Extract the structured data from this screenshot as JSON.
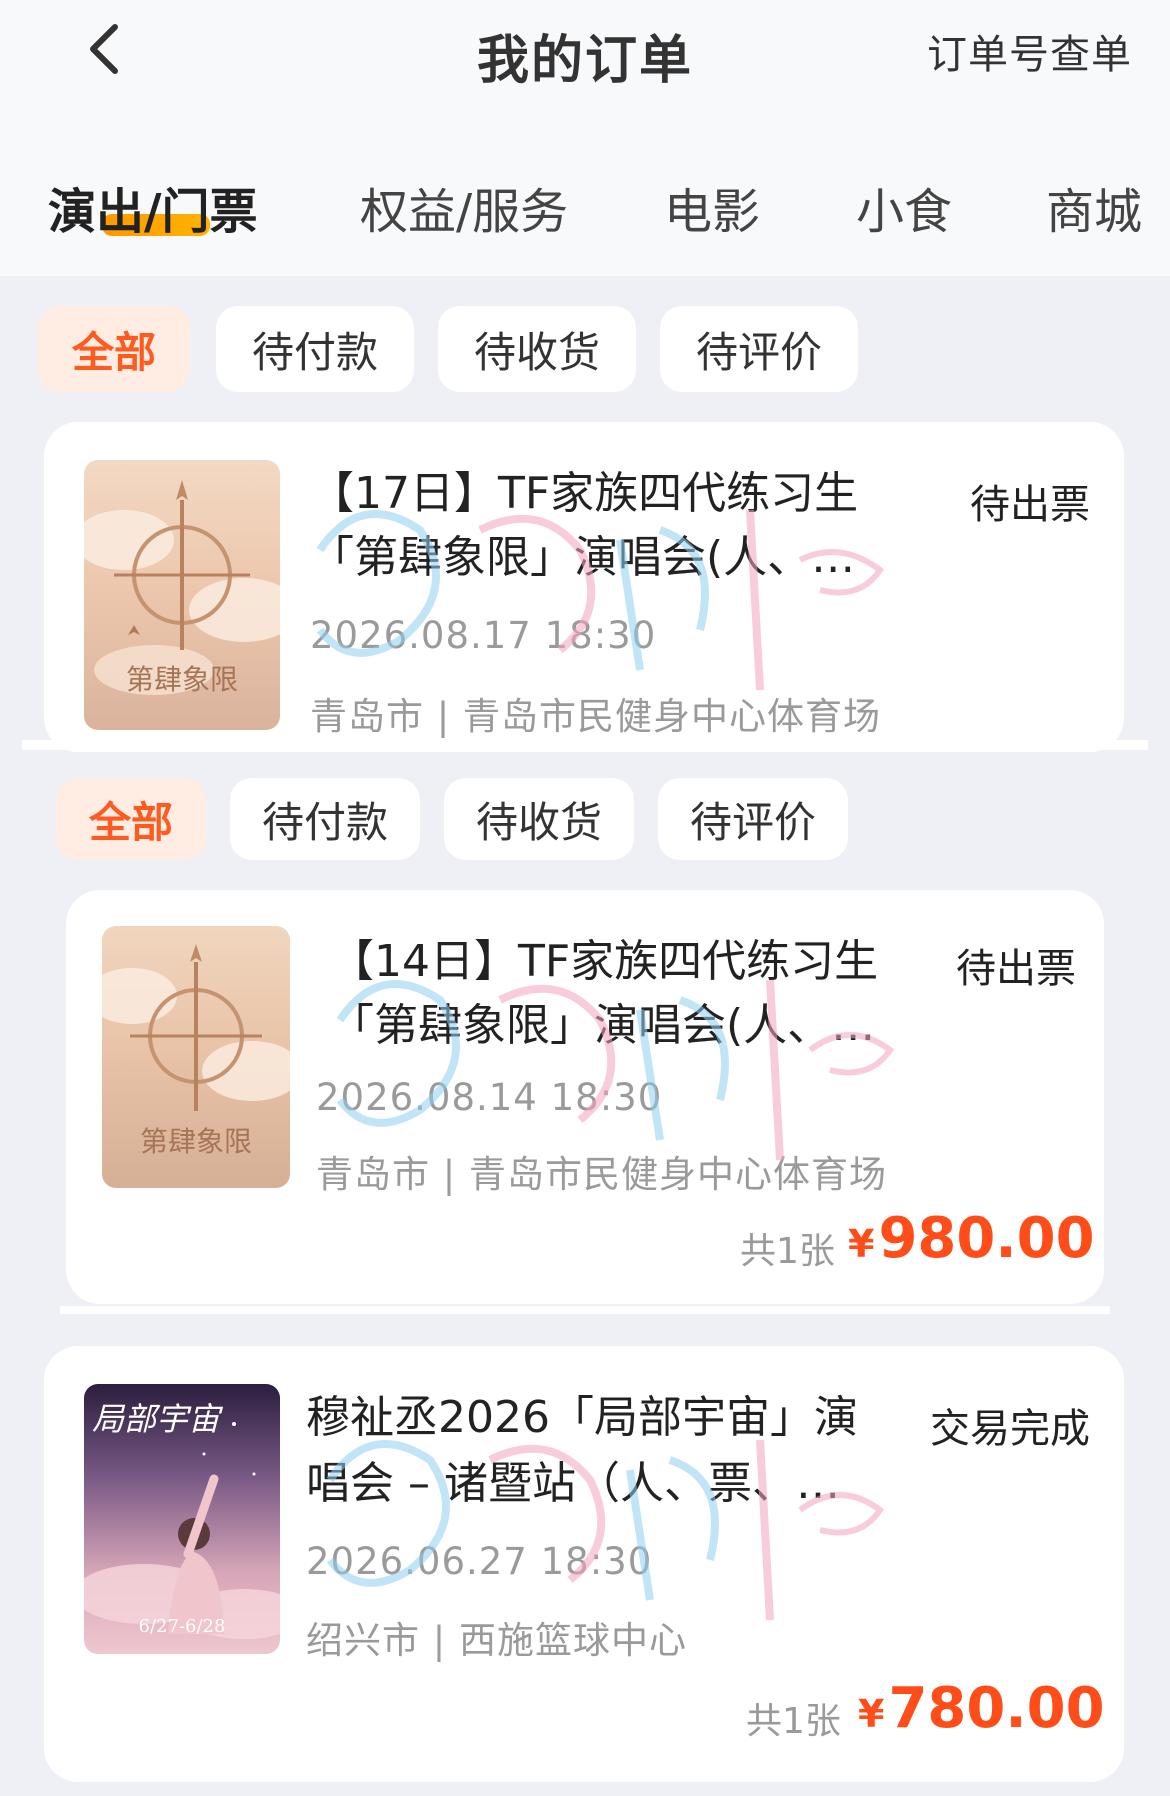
{
  "header": {
    "title": "我的订单",
    "order_lookup": "订单号查单"
  },
  "category_tabs": [
    {
      "label": "演出/门票"
    },
    {
      "label": "权益/服务"
    },
    {
      "label": "电影"
    },
    {
      "label": "小食"
    },
    {
      "label": "商城"
    }
  ],
  "filters_a": [
    "全部",
    "待付款",
    "待收货",
    "待评价"
  ],
  "filters_b": [
    "全部",
    "待付款",
    "待收货",
    "待评价"
  ],
  "orders": [
    {
      "title_line1": "【17日】TF家族四代练习生",
      "title_line2": "「第肆象限」演唱会(人、…",
      "status": "待出票",
      "datetime": "2026.08.17 18:30",
      "venue": "青岛市 | 青岛市民健身中心体育场",
      "poster_text": "第肆象限"
    },
    {
      "title_line1": "【14日】TF家族四代练习生",
      "title_line2": "「第肆象限」演唱会(人、…",
      "status": "待出票",
      "datetime": "2026.08.14 18:30",
      "venue": "青岛市 | 青岛市民健身中心体育场",
      "qty": "共1张",
      "currency": "¥",
      "price": "980.00",
      "poster_text": "第肆象限"
    },
    {
      "title_line1": "穆祉丞2026「局部宇宙」演",
      "title_line2": "唱会 – 诸暨站（人、票、…",
      "status": "交易完成",
      "datetime": "2026.06.27 18:30",
      "venue": "绍兴市 | 西施篮球中心",
      "qty": "共1张",
      "currency": "¥",
      "price": "780.00",
      "poster_text": "局部宇宙",
      "poster_date": "6/27-6/28"
    }
  ],
  "colors": {
    "accent": "#ff4d1a",
    "tab_underline": "#ffa500",
    "chip_active_bg": "#ffece3",
    "page_bg": "#eef0f5"
  }
}
